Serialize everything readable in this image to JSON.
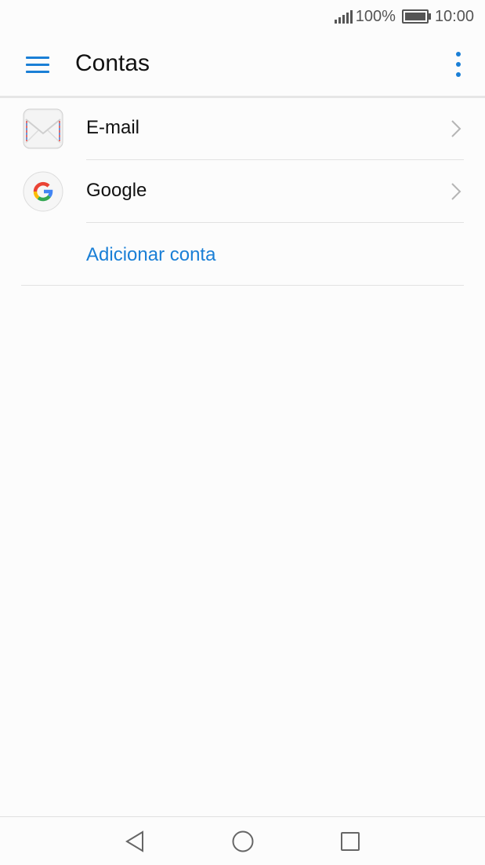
{
  "status_bar": {
    "battery_percent": "100%",
    "time": "10:00",
    "signal_icon": "signal-icon",
    "battery_icon": "battery-full-icon"
  },
  "app_bar": {
    "title": "Contas",
    "menu_icon": "hamburger-menu-icon",
    "more_icon": "more-vertical-icon"
  },
  "accounts": [
    {
      "label": "E-mail",
      "icon": "envelope-icon"
    },
    {
      "label": "Google",
      "icon": "google-logo-icon"
    }
  ],
  "add_account_label": "Adicionar conta",
  "nav_bar": {
    "back_icon": "back-triangle-icon",
    "home_icon": "home-circle-icon",
    "recents_icon": "recents-square-icon"
  },
  "colors": {
    "accent": "#1a7fd6",
    "background": "#fcfcfc",
    "text": "#111111"
  }
}
